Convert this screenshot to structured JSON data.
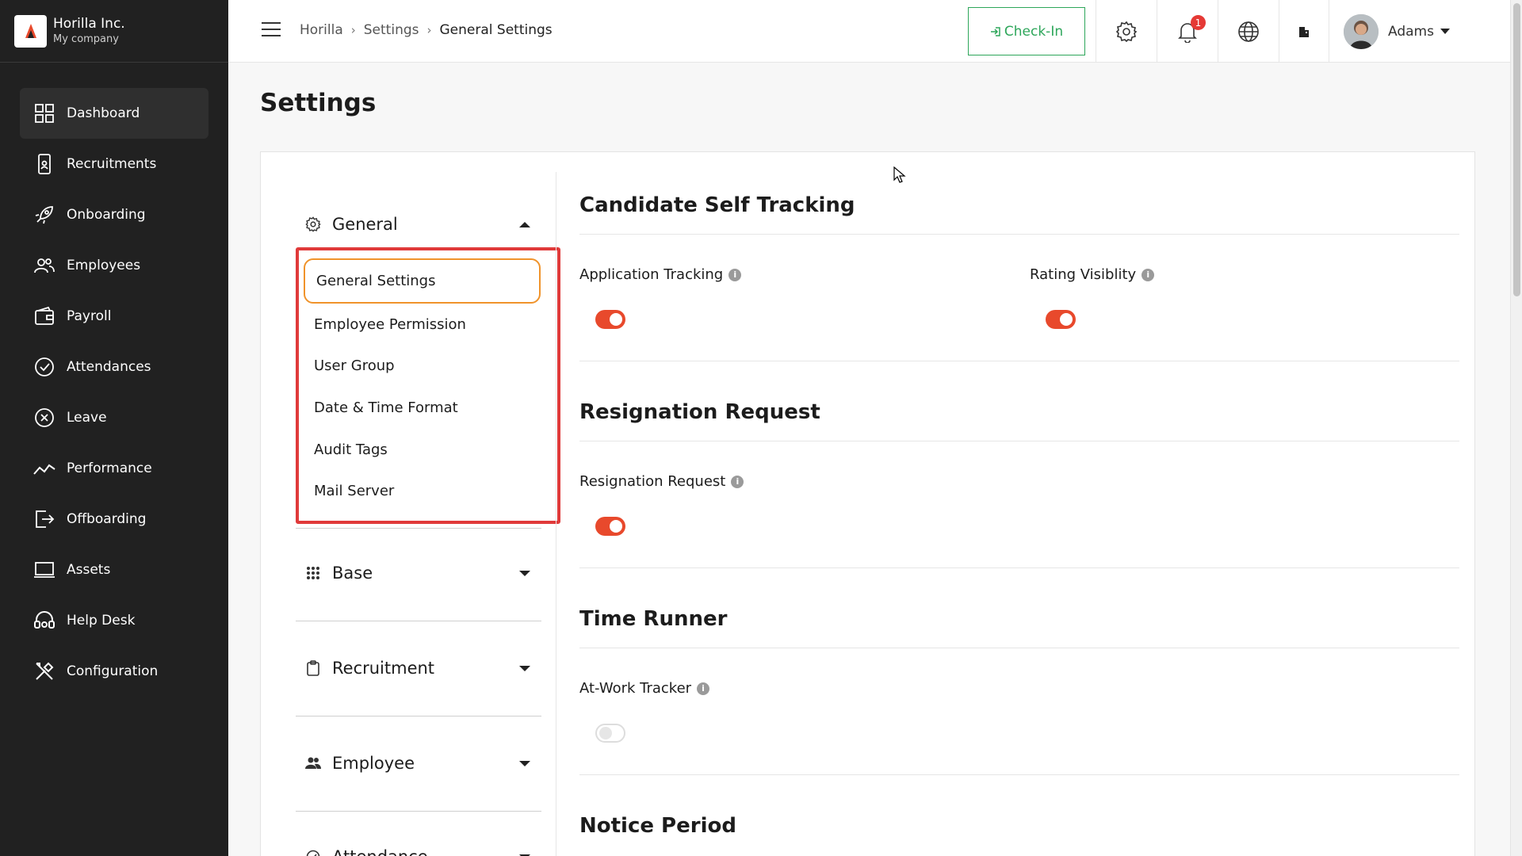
{
  "brand": {
    "name": "Horilla Inc.",
    "subtitle": "My company"
  },
  "sidebar": {
    "items": [
      {
        "label": "Dashboard",
        "icon": "dashboard-grid-icon",
        "active": true
      },
      {
        "label": "Recruitments",
        "icon": "phone-user-icon"
      },
      {
        "label": "Onboarding",
        "icon": "rocket-icon"
      },
      {
        "label": "Employees",
        "icon": "users-icon"
      },
      {
        "label": "Payroll",
        "icon": "wallet-icon"
      },
      {
        "label": "Attendances",
        "icon": "check-circle-icon"
      },
      {
        "label": "Leave",
        "icon": "x-circle-icon"
      },
      {
        "label": "Performance",
        "icon": "trend-line-icon"
      },
      {
        "label": "Offboarding",
        "icon": "exit-icon"
      },
      {
        "label": "Assets",
        "icon": "laptop-icon"
      },
      {
        "label": "Help Desk",
        "icon": "headset-icon"
      },
      {
        "label": "Configuration",
        "icon": "tools-icon"
      }
    ]
  },
  "header": {
    "breadcrumb": [
      "Horilla",
      "Settings",
      "General Settings"
    ],
    "checkin_label": "Check-In",
    "notification_count": "1",
    "user_name": "Adams"
  },
  "page": {
    "title": "Settings"
  },
  "settings_nav": {
    "general": {
      "label": "General",
      "items": [
        "General Settings",
        "Employee Permission",
        "User Group",
        "Date & Time Format",
        "Audit Tags",
        "Mail Server"
      ],
      "active": "General Settings"
    },
    "base": {
      "label": "Base"
    },
    "recruitment": {
      "label": "Recruitment"
    },
    "employee": {
      "label": "Employee"
    },
    "attendance": {
      "label": "Attendance"
    }
  },
  "content": {
    "candidate": {
      "title": "Candidate Self Tracking",
      "application_tracking": {
        "label": "Application Tracking",
        "on": true
      },
      "rating_visibility": {
        "label": "Rating Visiblity",
        "on": true
      }
    },
    "resignation": {
      "title": "Resignation Request",
      "field": {
        "label": "Resignation Request",
        "on": true
      }
    },
    "time_runner": {
      "title": "Time Runner",
      "field": {
        "label": "At-Work Tracker",
        "on": false
      }
    },
    "notice": {
      "title": "Notice Period"
    }
  },
  "colors": {
    "accent": "#e8492c",
    "highlight_box": "#e03a3a",
    "active_item": "#f0932b",
    "checkin": "#2da65a",
    "sidebar_bg": "#212121"
  }
}
